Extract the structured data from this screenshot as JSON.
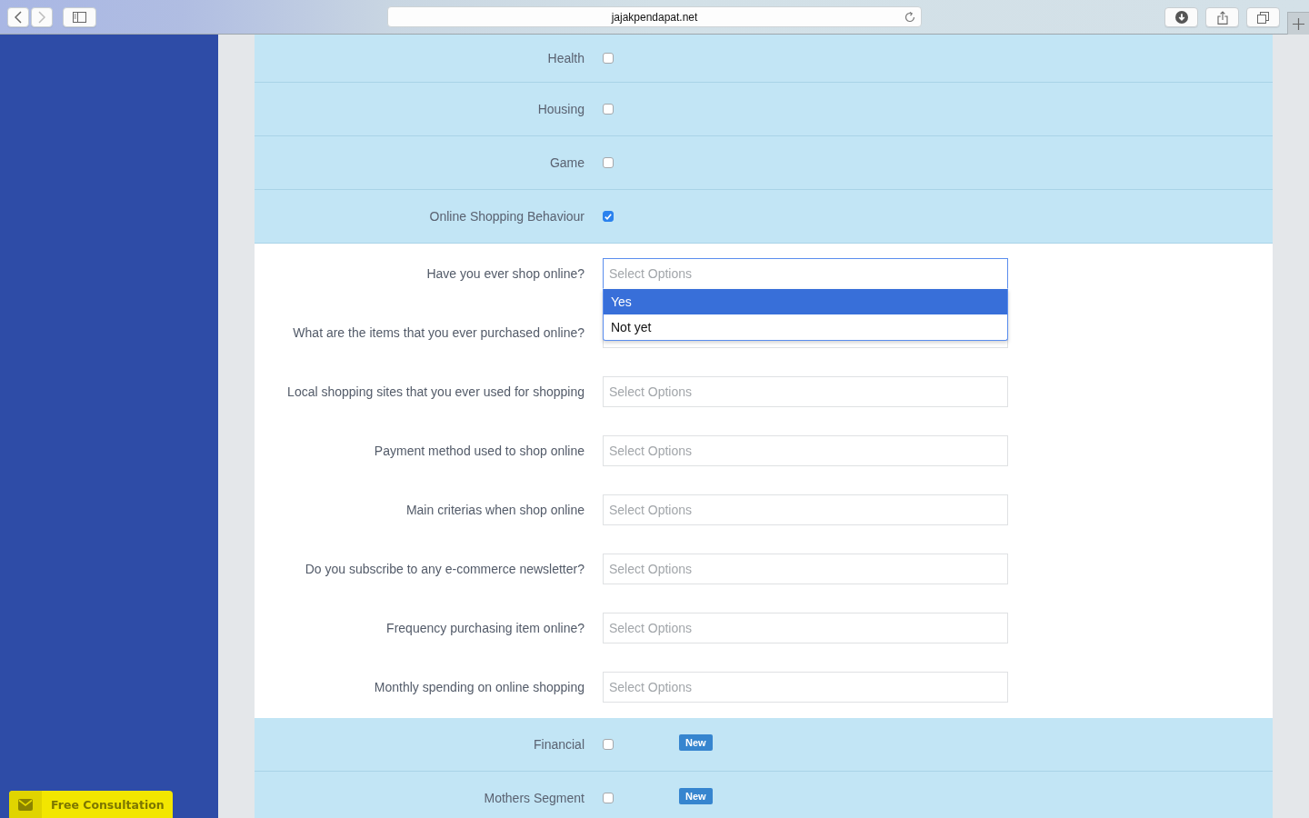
{
  "browser": {
    "url": "jajakpendapat.net",
    "back_enabled": true,
    "forward_enabled": false
  },
  "categories": [
    {
      "label": "Health",
      "checked": false
    },
    {
      "label": "Housing",
      "checked": false
    },
    {
      "label": "Game",
      "checked": false
    },
    {
      "label": "Online Shopping Behaviour",
      "checked": true,
      "questions": [
        {
          "label": "Have you ever shop online?",
          "placeholder": "Select Options",
          "open": true,
          "options": [
            {
              "label": "Yes",
              "selected": true
            },
            {
              "label": "Not yet",
              "selected": false
            }
          ]
        },
        {
          "label": "What are the items that you ever purchased online?",
          "open": false
        },
        {
          "label": "Local shopping sites that you ever used for shopping",
          "placeholder": "Select Options",
          "open": false
        },
        {
          "label": "Payment method used to shop online",
          "placeholder": "Select Options",
          "open": false
        },
        {
          "label": "Main criterias when shop online",
          "placeholder": "Select Options",
          "open": false
        },
        {
          "label": "Do you subscribe to any e-commerce newsletter?",
          "placeholder": "Select Options",
          "open": false
        },
        {
          "label": "Frequency purchasing item online?",
          "placeholder": "Select Options",
          "open": false
        },
        {
          "label": "Monthly spending on online shopping",
          "placeholder": "Select Options",
          "open": false
        }
      ]
    },
    {
      "label": "Financial",
      "checked": false,
      "badge": "New"
    },
    {
      "label": "Mothers Segment",
      "checked": false,
      "badge": "New"
    }
  ],
  "consultation_button": {
    "label": "Free Consultation"
  }
}
